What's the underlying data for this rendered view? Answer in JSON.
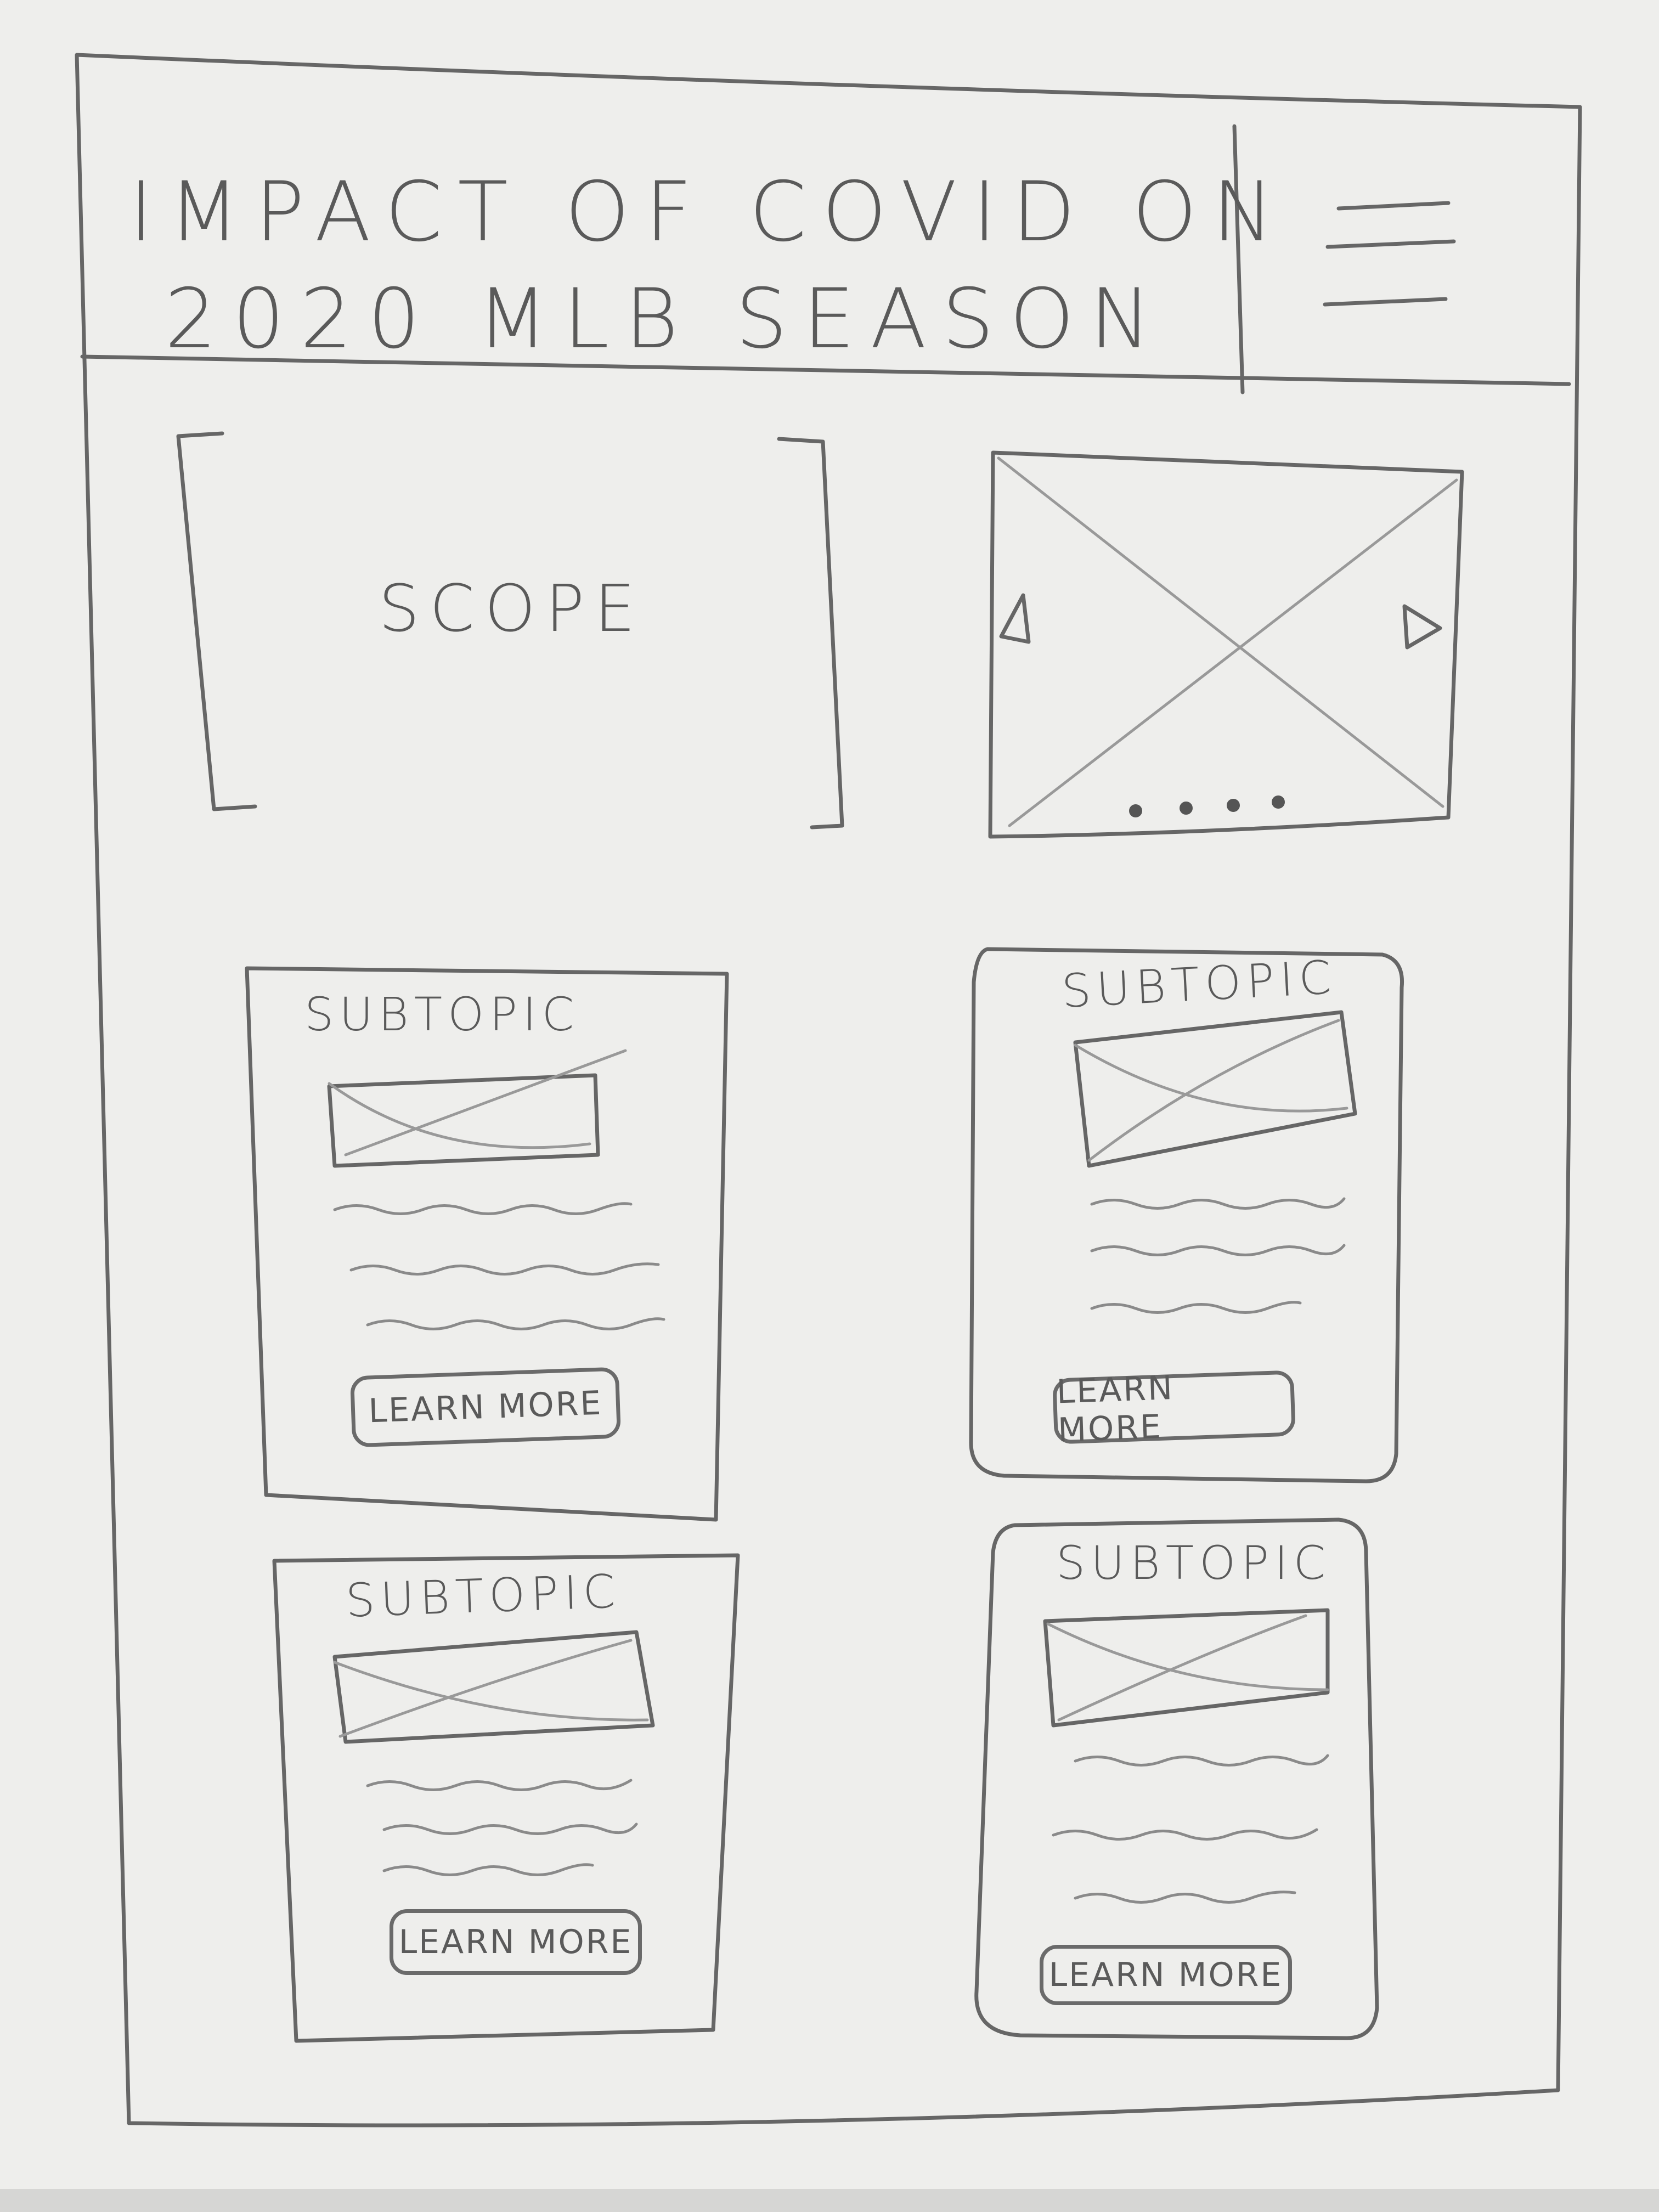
{
  "header": {
    "title_line1": "IMPACT OF COVID ON",
    "title_line2": "2020 MLB SEASON",
    "menu_icon": "hamburger-menu-icon"
  },
  "scope": {
    "label": "SCOPE"
  },
  "carousel": {
    "prev_icon": "triangle-left-icon",
    "next_icon": "triangle-right-icon",
    "image_icon": "image-placeholder-icon",
    "dots": 4
  },
  "cards": [
    {
      "title": "SUBTOPIC",
      "button": "LEARN MORE"
    },
    {
      "title": "SUBTOPIC",
      "button": "LEARN MORE"
    },
    {
      "title": "SUBTOPIC",
      "button": "LEARN MORE"
    },
    {
      "title": "SUBTOPIC",
      "button": "LEARN MORE"
    }
  ],
  "colors": {
    "paper": "#eeeeec",
    "pencil": "#5a5a5a"
  }
}
